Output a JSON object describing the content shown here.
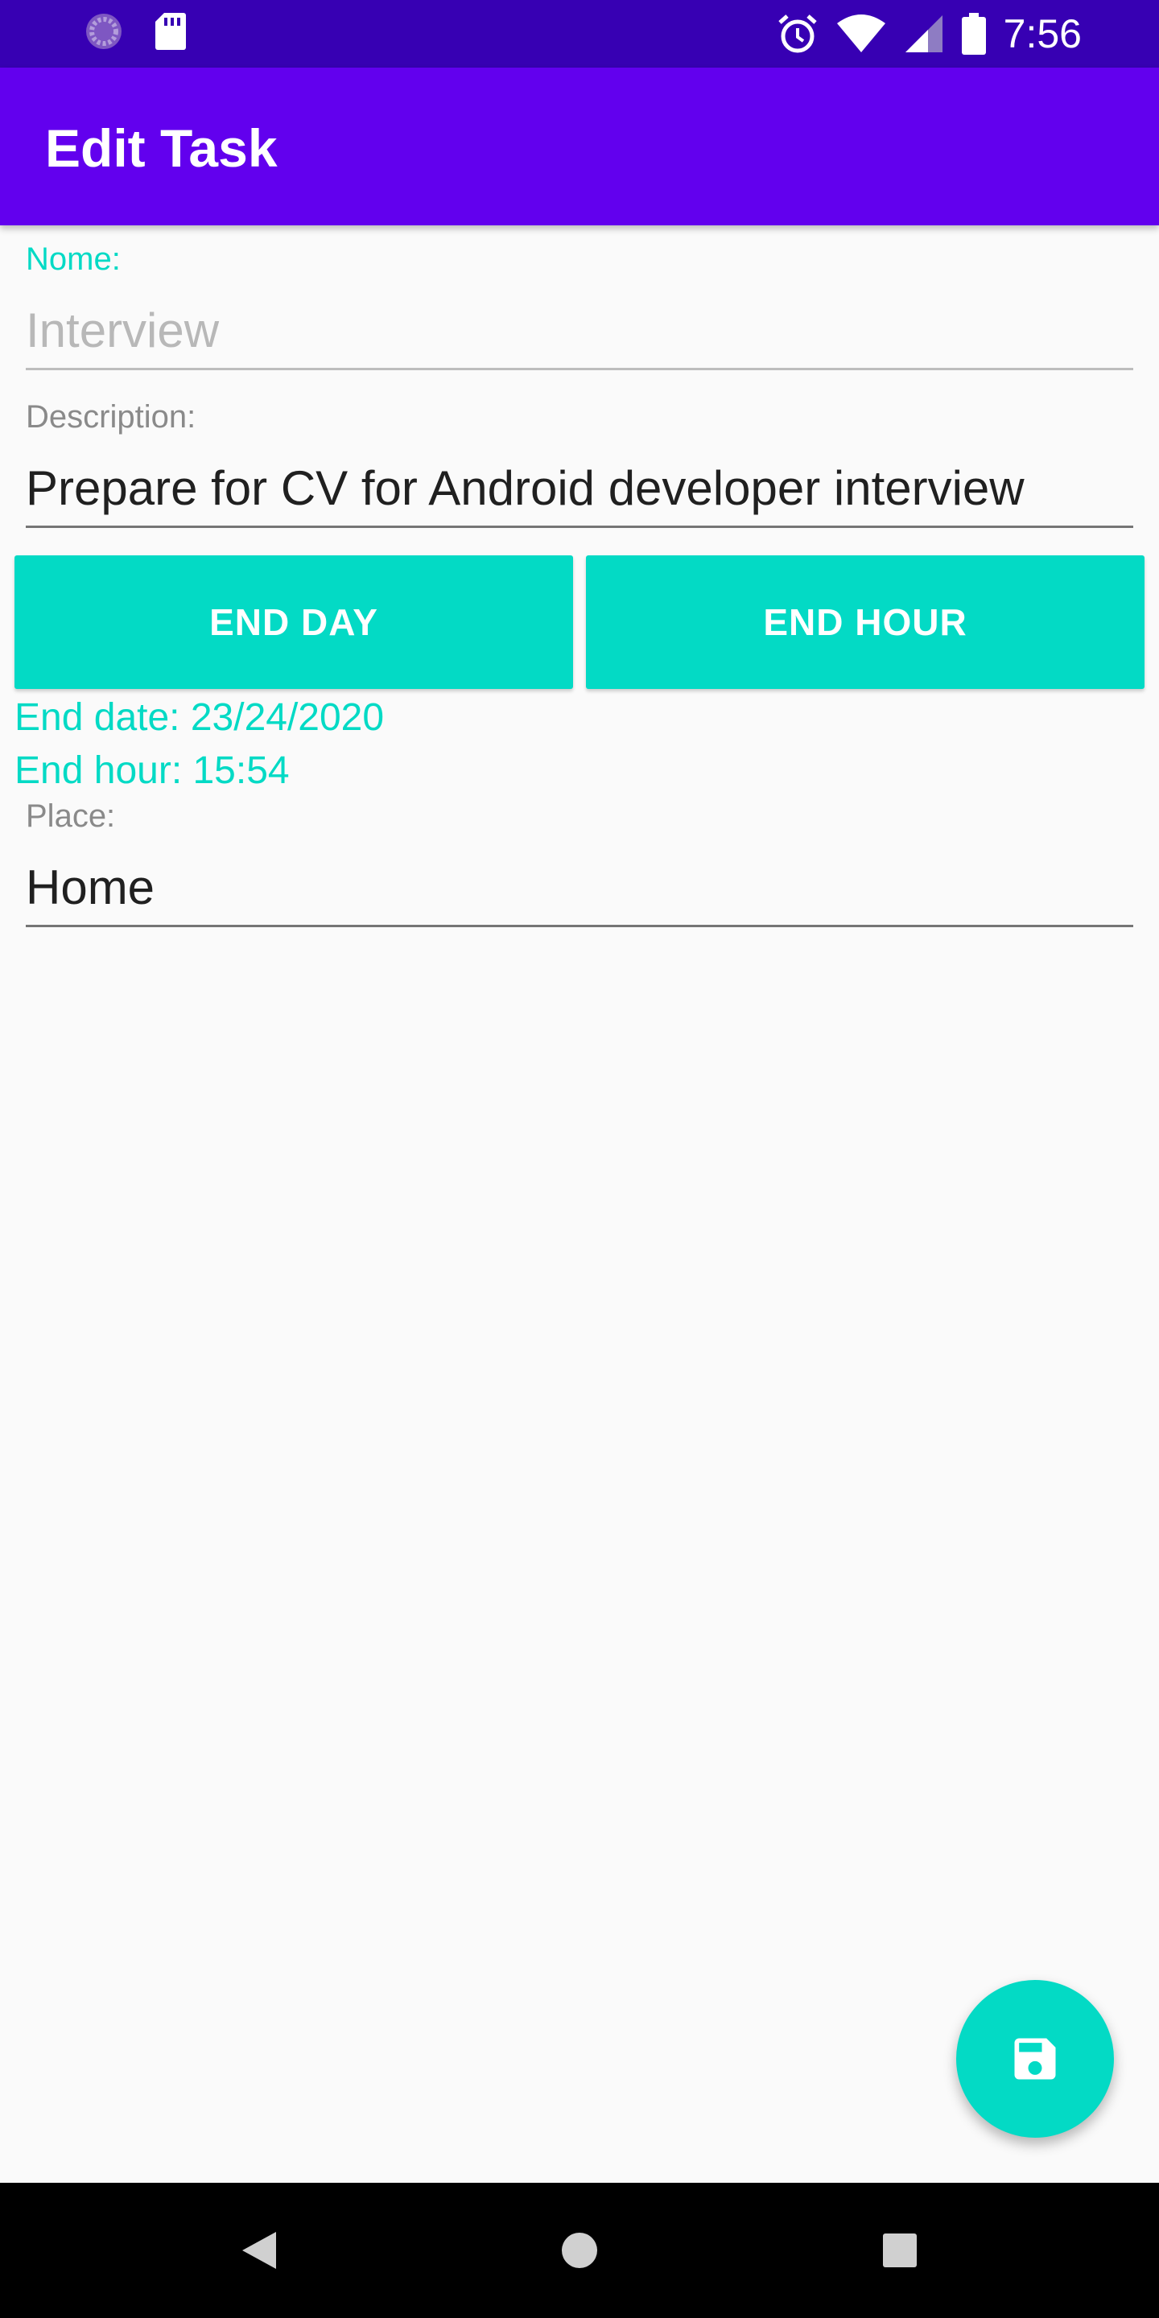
{
  "status_bar": {
    "time": "7:56",
    "icons": [
      "loading-icon",
      "sd-card-icon",
      "alarm-icon",
      "wifi-icon",
      "signal-icon",
      "battery-icon"
    ]
  },
  "app_bar": {
    "title": "Edit Task"
  },
  "form": {
    "name": {
      "label": "Nome:",
      "value": "",
      "placeholder": "Interview"
    },
    "description": {
      "label": "Description:",
      "value": "Prepare for CV for Android developer interview"
    },
    "end_day_button": "END DAY",
    "end_hour_button": "END HOUR",
    "end_date_text": "End date: 23/24/2020",
    "end_hour_text": "End hour: 15:54",
    "place": {
      "label": "Place:",
      "value": "Home"
    }
  },
  "fab": {
    "icon": "save-icon"
  },
  "nav_bar": {
    "icons": [
      "back-icon",
      "home-icon",
      "recents-icon"
    ]
  },
  "colors": {
    "status_bar": "#3700b3",
    "app_bar": "#6200ee",
    "accent": "#03dac5",
    "background": "#fafafa"
  }
}
